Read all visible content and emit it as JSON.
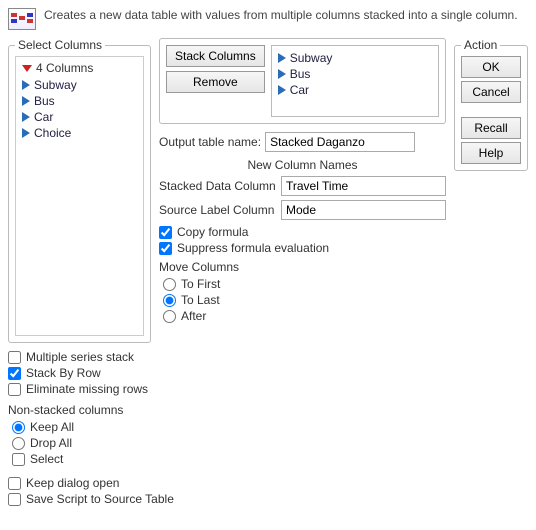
{
  "header": {
    "description": "Creates a new data table with values from multiple columns stacked into a single column."
  },
  "selectColumns": {
    "legend": "Select Columns",
    "count_label": "4 Columns",
    "items": [
      "Subway",
      "Bus",
      "Car",
      "Choice"
    ]
  },
  "stackPanel": {
    "stack_btn": "Stack Columns",
    "remove_btn": "Remove",
    "stacked_items": [
      "Subway",
      "Bus",
      "Car"
    ]
  },
  "outputTable": {
    "label": "Output table name:",
    "value": "Stacked Daganzo"
  },
  "newColNames": {
    "heading": "New Column Names",
    "stacked_label": "Stacked Data Column",
    "stacked_value": "Travel Time",
    "source_label": "Source Label Column",
    "source_value": "Mode"
  },
  "options": {
    "copy_formula": "Copy formula",
    "suppress": "Suppress formula evaluation"
  },
  "moveColumns": {
    "heading": "Move Columns",
    "to_first": "To First",
    "to_last": "To Last",
    "after": "After"
  },
  "leftChecks": {
    "multiple": "Multiple series stack",
    "stack_by_row": "Stack By Row",
    "eliminate": "Eliminate missing rows"
  },
  "nonStacked": {
    "heading": "Non-stacked columns",
    "keep_all": "Keep All",
    "drop_all": "Drop All",
    "select": "Select"
  },
  "bottom": {
    "keep_dialog": "Keep dialog open",
    "save_script": "Save Script to Source Table"
  },
  "action": {
    "legend": "Action",
    "ok": "OK",
    "cancel": "Cancel",
    "recall": "Recall",
    "help": "Help"
  }
}
